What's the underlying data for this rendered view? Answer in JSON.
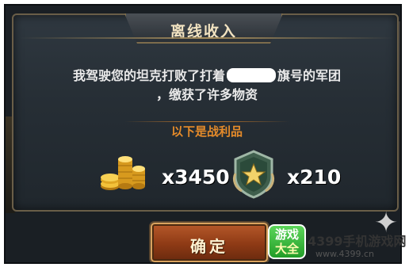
{
  "dialog": {
    "title": "离线收入",
    "message_line1_before": "我驾驶您的坦克打败了打着",
    "message_line1_after": "旗号的军团",
    "message_line2": "，缴获了许多物资",
    "rewards_label": "以下是战利品",
    "rewards": [
      {
        "icon": "gold-coins-icon",
        "quantity": "x3450"
      },
      {
        "icon": "star-medal-icon",
        "quantity": "x210"
      }
    ],
    "confirm_label": "确定"
  },
  "watermark": {
    "badge_top": "游戏",
    "badge_bottom": "大全",
    "name": "4399手机游戏网",
    "url": "www.4399.cn"
  },
  "colors": {
    "title_text": "#f1e2c0",
    "rewards_label": "#e58b2a",
    "button": "#8e3a15",
    "brand_green": "#229d28"
  }
}
